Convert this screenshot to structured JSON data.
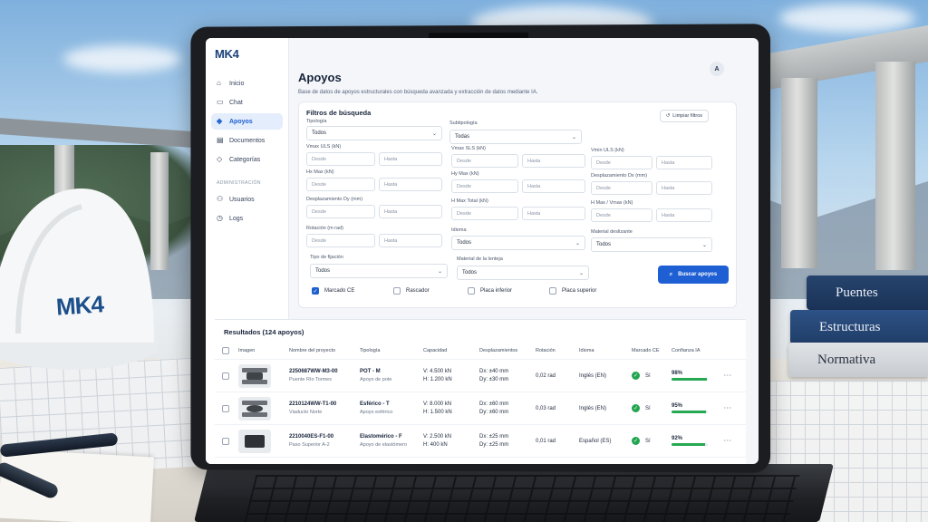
{
  "app": {
    "logo": "MK4",
    "user_initial": "A"
  },
  "sidebar": {
    "items": [
      {
        "label": "Inicio",
        "icon": "home-icon"
      },
      {
        "label": "Chat",
        "icon": "chat-icon"
      },
      {
        "label": "Apoyos",
        "icon": "support-icon",
        "active": true
      },
      {
        "label": "Documentos",
        "icon": "document-icon"
      },
      {
        "label": "Categorías",
        "icon": "tag-icon"
      }
    ],
    "section_admin": "ADMINISTRACIÓN",
    "admin_items": [
      {
        "label": "Usuarios",
        "icon": "users-icon"
      },
      {
        "label": "Logs",
        "icon": "clock-icon"
      }
    ]
  },
  "header": {
    "title": "Apoyos",
    "subtitle": "Base de datos de apoyos estructurales con búsqueda avanzada y extracción de datos mediante IA."
  },
  "filters": {
    "title": "Filtros de búsqueda",
    "clear_label": "Limpiar filtros",
    "tipologia_label": "Tipología",
    "tipologia_value": "Todos",
    "subtipologia_label": "Subtipología",
    "subtipologia_value": "Todas",
    "vmax_uls_label": "Vmax ULS (kN)",
    "vmax_sls_label": "Vmax SLS (kN)",
    "vmin_uls_label": "Vmin ULS (kN)",
    "hx_max_label": "Hx Max (kN)",
    "hy_max_label": "Hy Max (kN)",
    "desp_dx_label": "Desplazamiento Dx (mm)",
    "desp_dy_label": "Desplazamiento Dy (mm)",
    "h_max_total_label": "H Max Total (kN)",
    "h_max_vmax_label": "H Max / Vmax (kN)",
    "rotacion_label": "Rotación (m rad)",
    "idioma_label": "Idioma",
    "idioma_value": "Todos",
    "material_deslizante_label": "Material deslizante",
    "material_deslizante_value": "Todos",
    "tipo_fijacion_label": "Tipo de fijación",
    "tipo_fijacion_value": "Todos",
    "material_lenteja_label": "Material de la lenteja",
    "material_lenteja_value": "Todos",
    "desde": "Desde",
    "hasta": "Hasta",
    "checks": [
      {
        "label": "Marcado CE",
        "checked": true
      },
      {
        "label": "Rascador",
        "checked": false
      },
      {
        "label": "Placa inferior",
        "checked": false
      },
      {
        "label": "Placa superior",
        "checked": false
      }
    ],
    "search_button": "Buscar apoyos"
  },
  "results": {
    "title": "Resultados (124 apoyos)",
    "columns": [
      "Imagen",
      "Nombre del proyecto",
      "Tipología",
      "Capacidad",
      "Desplazamientos",
      "Rotación",
      "Idioma",
      "Marcado CE",
      "Confianza IA"
    ],
    "rows": [
      {
        "code": "2250687WW-M3-00",
        "project": "Puente Río Tormes",
        "type": "POT - M",
        "type_sub": "Apoyo de pote",
        "cap_v": "V: 4.500 kN",
        "cap_h": "H: 1.200 kN",
        "dx": "Dx: ±40 mm",
        "dy": "Dy: ±30 mm",
        "rot": "0,02 rad",
        "lang": "Inglés (EN)",
        "ce": "Sí",
        "conf": "98%",
        "conf_value": 0.98
      },
      {
        "code": "2210124WW-T1-00",
        "project": "Viaducto Norte",
        "type": "Esférico - T",
        "type_sub": "Apoyo esférico",
        "cap_v": "V: 8.000 kN",
        "cap_h": "H: 1.500 kN",
        "dx": "Dx: ±60 mm",
        "dy": "Dy: ±60 mm",
        "rot": "0,03 rad",
        "lang": "Inglés (EN)",
        "ce": "Sí",
        "conf": "95%",
        "conf_value": 0.95
      },
      {
        "code": "2210040ES-F1-00",
        "project": "Paso Superior A-2",
        "type": "Elastomérico - F",
        "type_sub": "Apoyo de elastómero",
        "cap_v": "V: 2.500 kN",
        "cap_h": "H: 400 kN",
        "dx": "Dx: ±25 mm",
        "dy": "Dy: ±25 mm",
        "rot": "0,01 rad",
        "lang": "Español (ES)",
        "ce": "Sí",
        "conf": "92%",
        "conf_value": 0.92
      }
    ]
  },
  "scene": {
    "hardhat_logo": "MK4",
    "books": [
      "Puentes",
      "Estructuras",
      "Normativa"
    ]
  },
  "colors": {
    "accent": "#1e5fd4",
    "success": "#22a550",
    "brand": "#1a3f7a"
  }
}
